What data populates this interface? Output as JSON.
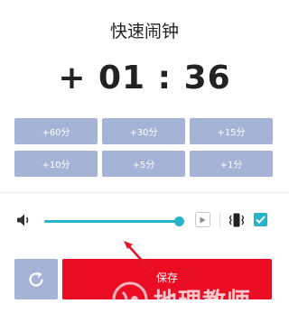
{
  "dialog": {
    "title": "快速闹钟",
    "time": "+ 01 : 36"
  },
  "quick_buttons": [
    {
      "label": "+60分"
    },
    {
      "label": "+30分"
    },
    {
      "label": "+15分"
    },
    {
      "label": "+10分"
    },
    {
      "label": "+5分"
    },
    {
      "label": "+1分"
    }
  ],
  "sound": {
    "volume_level": 1.0,
    "vibrate_checked": true
  },
  "actions": {
    "save_label": "保存"
  },
  "watermark": {
    "text": "地理教师"
  },
  "colors": {
    "accent": "#26b4c8",
    "button_blue": "#a4b3d6",
    "save_red": "#ea0d23",
    "annotation_arrow": "#e8132a"
  }
}
